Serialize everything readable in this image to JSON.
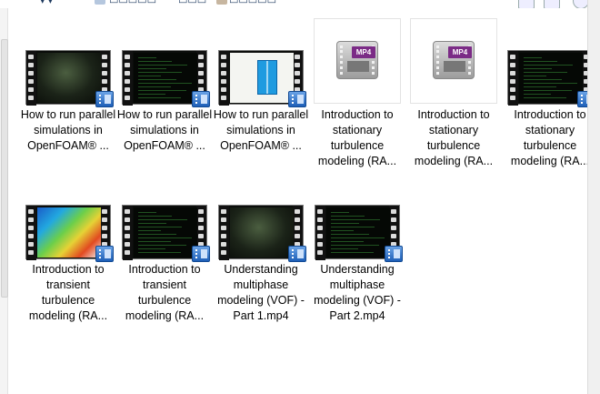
{
  "toolbar": {
    "items": [
      {
        "name": "toolbar-item-1",
        "label": "▾ ▾"
      },
      {
        "name": "toolbar-item-2",
        "label": "▭▭▭▭▭"
      },
      {
        "name": "toolbar-item-3",
        "label": "▭▭▭"
      },
      {
        "name": "toolbar-item-4",
        "label": "▭▭▭▭▭"
      }
    ]
  },
  "files": [
    {
      "label": "How to run parallel simulations in OpenFOAM® ...",
      "thumb": "green"
    },
    {
      "label": "How to run parallel simulations in OpenFOAM® ...",
      "thumb": "dark"
    },
    {
      "label": "How to run parallel simulations in OpenFOAM® ...",
      "thumb": "white"
    },
    {
      "label": "Introduction to stationary turbulence modeling (RA...",
      "thumb": "mp4",
      "badge": "MP4"
    },
    {
      "label": "Introduction to stationary turbulence modeling (RA...",
      "thumb": "mp4",
      "badge": "MP4"
    },
    {
      "label": "Introduction to stationary turbulence modeling (RA...",
      "thumb": "dark"
    },
    {
      "label": "Introduction to transient turbulence modeling (RA...",
      "thumb": "map"
    },
    {
      "label": "Introduction to transient turbulence modeling (RA...",
      "thumb": "dark"
    },
    {
      "label": "Understanding multiphase modeling (VOF) - Part 1.mp4",
      "thumb": "green"
    },
    {
      "label": "Understanding multiphase modeling (VOF) - Part 2.mp4",
      "thumb": "dark"
    }
  ]
}
